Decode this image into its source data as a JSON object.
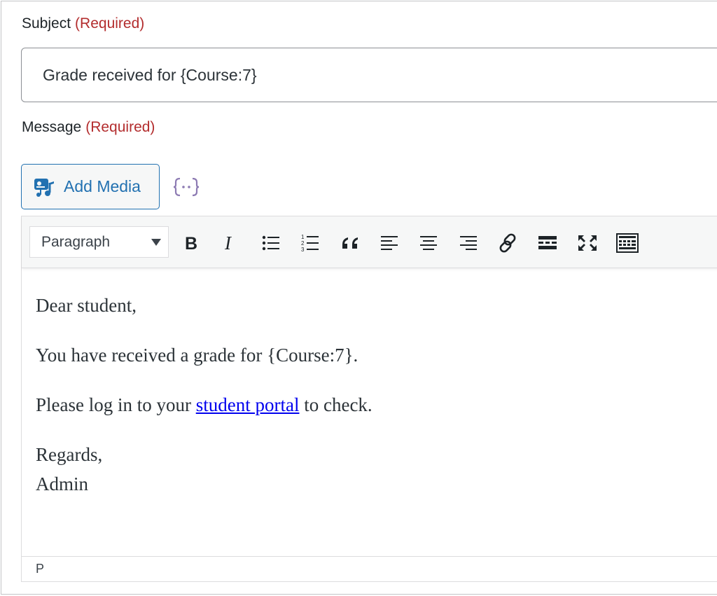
{
  "subject": {
    "label": "Subject",
    "required": "(Required)",
    "value": "Grade received for {Course:7}"
  },
  "message": {
    "label": "Message",
    "required": "(Required)"
  },
  "add_media": {
    "label": "Add Media",
    "icon": "media-icon"
  },
  "merge_tags": {
    "icon": "merge-tags-icon",
    "glyph": "{··}"
  },
  "toolbar": {
    "format_select": "Paragraph",
    "buttons": [
      "bold-icon",
      "italic-icon",
      "bulleted-list-icon",
      "numbered-list-icon",
      "blockquote-icon",
      "align-left-icon",
      "align-center-icon",
      "align-right-icon",
      "link-icon",
      "read-more-icon",
      "fullscreen-icon",
      "toolbar-toggle-icon"
    ]
  },
  "body": {
    "line1": "Dear student,",
    "line2": "You have received a grade for {Course:7}.",
    "line3_before": "Please log in to your ",
    "line3_link": "student portal",
    "line3_after": " to check.",
    "line4a": "Regards,",
    "line4b": "Admin"
  },
  "statusbar": {
    "path": "P"
  },
  "colors": {
    "required": "#b32d2e",
    "accent": "#2271b1",
    "link": "#0000ee"
  }
}
